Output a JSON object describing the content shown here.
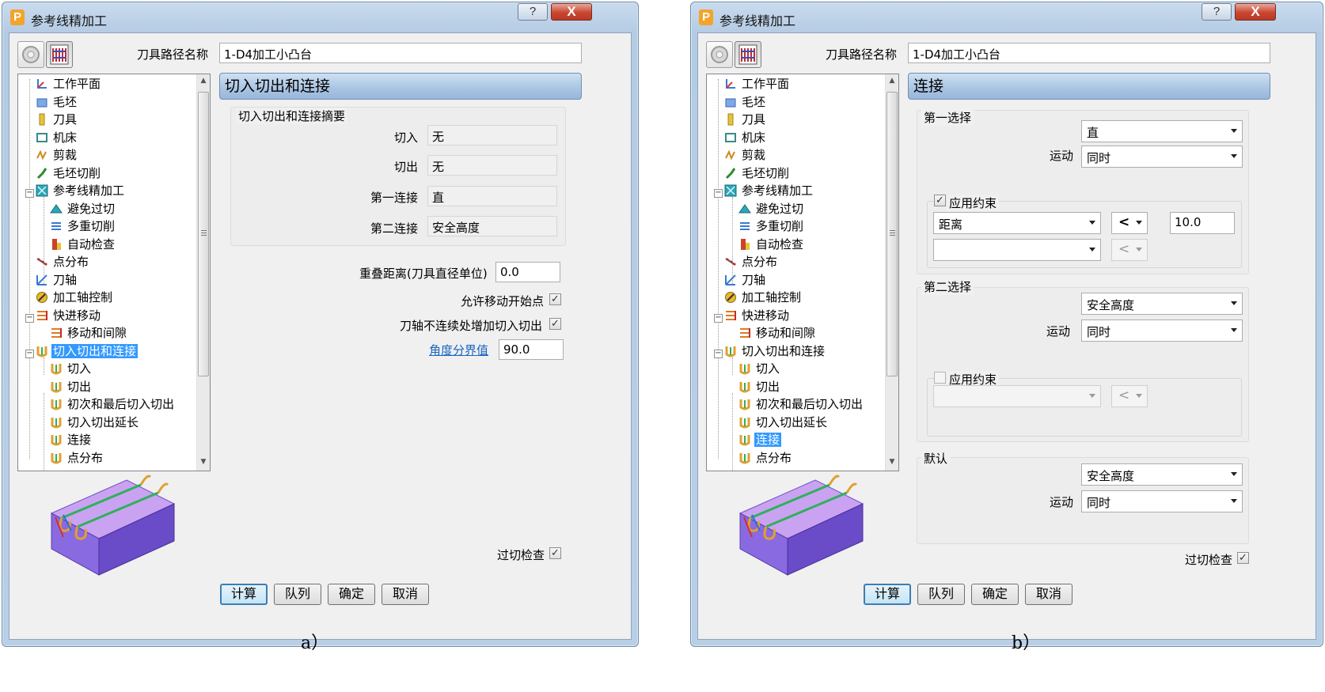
{
  "colors": {
    "titlebar": "#c4d7ec",
    "selection": "#3399ff",
    "header_bar": "#a9c4e3",
    "link": "#1565c0",
    "block_top": "#c9a3f2",
    "block_side": "#7a5bd6",
    "toolpath": "#2fb05a",
    "lead_arc": "#e0a030"
  },
  "icons": {
    "app": "powermill-logo",
    "help": "help-icon",
    "close": "close-icon",
    "toolbar1": "gear-icon",
    "toolbar2": "toolpath-strategy-icon"
  },
  "win_a": {
    "title": "参考线精加工",
    "help": "?",
    "close": "X",
    "path_name_label": "刀具路径名称",
    "path_name_value": "1-D4加工小凸台",
    "tree": [
      "工作平面",
      "毛坯",
      "刀具",
      "机床",
      "剪裁",
      "毛坯切削",
      "参考线精加工",
      "避免过切",
      "多重切削",
      "自动检查",
      "点分布",
      "刀轴",
      "加工轴控制",
      "快进移动",
      "移动和间隙",
      "切入切出和连接",
      "切入",
      "切出",
      "初次和最后切入切出",
      "切入切出延长",
      "连接",
      "点分布"
    ],
    "header": "切入切出和连接",
    "summary_title": "切入切出和连接摘要",
    "summary": [
      {
        "label": "切入",
        "value": "无"
      },
      {
        "label": "切出",
        "value": "无"
      },
      {
        "label": "第一连接",
        "value": "直"
      },
      {
        "label": "第二连接",
        "value": "安全高度"
      }
    ],
    "overlap_label": "重叠距离(刀具直径单位)",
    "overlap_value": "0.0",
    "allow_move_start": "允许移动开始点",
    "allow_move_start_checked": "✓",
    "add_leadin_label": "刀轴不连续处增加切入切出",
    "add_leadin_checked": "✓",
    "angle_link": "角度分界值",
    "angle_value": "90.0",
    "gouge_check": "过切检查",
    "gouge_checked": "✓",
    "buttons": {
      "calc": "计算",
      "queue": "队列",
      "ok": "确定",
      "cancel": "取消"
    }
  },
  "win_b": {
    "title": "参考线精加工",
    "help": "?",
    "close": "X",
    "path_name_label": "刀具路径名称",
    "path_name_value": "1-D4加工小凸台",
    "tree": [
      "工作平面",
      "毛坯",
      "刀具",
      "机床",
      "剪裁",
      "毛坯切削",
      "参考线精加工",
      "避免过切",
      "多重切削",
      "自动检查",
      "点分布",
      "刀轴",
      "加工轴控制",
      "快进移动",
      "移动和间隙",
      "切入切出和连接",
      "切入",
      "切出",
      "初次和最后切入切出",
      "切入切出延长",
      "连接",
      "点分布"
    ],
    "header": "连接",
    "first": {
      "title": "第一选择",
      "type": "直",
      "motion_label": "运动",
      "motion": "同时",
      "apply_label": "应用约束",
      "apply_checked": "✓",
      "constraint": "距离",
      "op": "<",
      "value": "10.0",
      "constraint2": "",
      "op2": "<"
    },
    "second": {
      "title": "第二选择",
      "type": "安全高度",
      "motion_label": "运动",
      "motion": "同时",
      "apply_label": "应用约束",
      "apply_checked": "",
      "constraint": "",
      "op": "<"
    },
    "default": {
      "title": "默认",
      "type": "安全高度",
      "motion_label": "运动",
      "motion": "同时"
    },
    "gouge_check": "过切检查",
    "gouge_checked": "✓",
    "buttons": {
      "calc": "计算",
      "queue": "队列",
      "ok": "确定",
      "cancel": "取消"
    }
  },
  "captions": {
    "a": "a）",
    "b": "b）"
  }
}
